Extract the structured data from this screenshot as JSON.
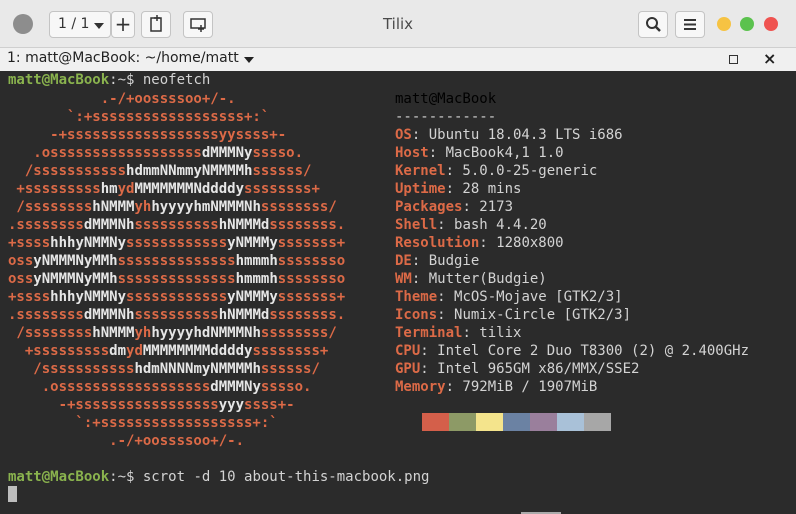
{
  "window": {
    "title": "Tilix"
  },
  "toolbar": {
    "page_selector": "1 / 1",
    "plus": "+"
  },
  "tab": {
    "label": "1: matt@MacBook: ~/home/matt",
    "close": "×"
  },
  "prompt": {
    "user_host": "matt@MacBook",
    "path": ":~$ ",
    "cmd1": "neofetch",
    "cmd2": "scrot -d 10 about-this-macbook.png"
  },
  "logo": [
    [
      [
        "o",
        "           .-/+oossssoo+/-."
      ]
    ],
    [
      [
        "o",
        "       `:+ssssssssssssssssss+:`"
      ]
    ],
    [
      [
        "o",
        "     -+ssssssssssssssssssyyssss+-"
      ]
    ],
    [
      [
        "o",
        "   .ossssssssssssssssss"
      ],
      [
        "w",
        "dMMMNy"
      ],
      [
        "o",
        "sssso."
      ]
    ],
    [
      [
        "o",
        "  /sssssssssss"
      ],
      [
        "w",
        "hdmmNNmmyNMMMMh"
      ],
      [
        "o",
        "ssssss/"
      ]
    ],
    [
      [
        "o",
        " +sssssssss"
      ],
      [
        "w",
        "hm"
      ],
      [
        "o",
        "yd"
      ],
      [
        "w",
        "MMMMMMMNddddy"
      ],
      [
        "o",
        "ssssssss+"
      ]
    ],
    [
      [
        "o",
        " /ssssssss"
      ],
      [
        "w",
        "hNMMM"
      ],
      [
        "o",
        "yh"
      ],
      [
        "w",
        "hyyyyhmNMMMNh"
      ],
      [
        "o",
        "ssssssss/"
      ]
    ],
    [
      [
        "o",
        ".ssssssss"
      ],
      [
        "w",
        "dMMMNh"
      ],
      [
        "o",
        "ssssssssss"
      ],
      [
        "w",
        "hNMMMd"
      ],
      [
        "o",
        "ssssssss."
      ]
    ],
    [
      [
        "o",
        "+ssss"
      ],
      [
        "w",
        "hhhyNMMNy"
      ],
      [
        "o",
        "ssssssssssss"
      ],
      [
        "w",
        "yNMMMy"
      ],
      [
        "o",
        "sssssss+"
      ]
    ],
    [
      [
        "o",
        "oss"
      ],
      [
        "w",
        "yNMMMNyMMh"
      ],
      [
        "o",
        "ssssssssssssss"
      ],
      [
        "w",
        "hmmmh"
      ],
      [
        "o",
        "ssssssso"
      ]
    ],
    [
      [
        "o",
        "oss"
      ],
      [
        "w",
        "yNMMMNyMMh"
      ],
      [
        "o",
        "ssssssssssssss"
      ],
      [
        "w",
        "hmmmh"
      ],
      [
        "o",
        "ssssssso"
      ]
    ],
    [
      [
        "o",
        "+ssss"
      ],
      [
        "w",
        "hhhyNMMNy"
      ],
      [
        "o",
        "ssssssssssss"
      ],
      [
        "w",
        "yNMMMy"
      ],
      [
        "o",
        "sssssss+"
      ]
    ],
    [
      [
        "o",
        ".ssssssss"
      ],
      [
        "w",
        "dMMMNh"
      ],
      [
        "o",
        "ssssssssss"
      ],
      [
        "w",
        "hNMMMd"
      ],
      [
        "o",
        "ssssssss."
      ]
    ],
    [
      [
        "o",
        " /ssssssss"
      ],
      [
        "w",
        "hNMMM"
      ],
      [
        "o",
        "yh"
      ],
      [
        "w",
        "hyyyyhdNMMMNh"
      ],
      [
        "o",
        "ssssssss/"
      ]
    ],
    [
      [
        "o",
        "  +sssssssss"
      ],
      [
        "w",
        "dm"
      ],
      [
        "o",
        "yd"
      ],
      [
        "w",
        "MMMMMMMMddddy"
      ],
      [
        "o",
        "ssssssss+"
      ]
    ],
    [
      [
        "o",
        "   /sssssssssss"
      ],
      [
        "w",
        "hdmNNNNmyNMMMMh"
      ],
      [
        "o",
        "ssssss/"
      ]
    ],
    [
      [
        "o",
        "    .ossssssssssssssssss"
      ],
      [
        "w",
        "dMMMNy"
      ],
      [
        "o",
        "sssso."
      ]
    ],
    [
      [
        "o",
        "      -+sssssssssssssssss"
      ],
      [
        "w",
        "yyy"
      ],
      [
        "o",
        "ssss+-"
      ]
    ],
    [
      [
        "o",
        "        `:+ssssssssssssssssss+:`"
      ]
    ],
    [
      [
        "o",
        "            .-/+oossssoo+/-."
      ]
    ]
  ],
  "info": {
    "title": "matt@MacBook",
    "separator": "------------",
    "rows": [
      [
        "OS",
        ": Ubuntu 18.04.3 LTS i686"
      ],
      [
        "Host",
        ": MacBook4,1 1.0"
      ],
      [
        "Kernel",
        ": 5.0.0-25-generic"
      ],
      [
        "Uptime",
        ": 28 mins"
      ],
      [
        "Packages",
        ": 2173"
      ],
      [
        "Shell",
        ": bash 4.4.20"
      ],
      [
        "Resolution",
        ": 1280x800"
      ],
      [
        "DE",
        ": Budgie"
      ],
      [
        "WM",
        ": Mutter(Budgie)"
      ],
      [
        "Theme",
        ": McOS-Mojave [GTK2/3]"
      ],
      [
        "Icons",
        ": Numix-Circle [GTK2/3]"
      ],
      [
        "Terminal",
        ": tilix"
      ],
      [
        "CPU",
        ": Intel Core 2 Duo T8300 (2) @ 2.400GHz"
      ],
      [
        "GPU",
        ": Intel 965GM x86/MMX/SSE2"
      ],
      [
        "Memory",
        ": 792MiB / 1907MiB"
      ]
    ]
  },
  "palette": [
    "#d45f4a",
    "#8d9a66",
    "#f4e48c",
    "#6b82a3",
    "#9a7f9c",
    "#a9c1d8",
    "#a7a7a7"
  ]
}
